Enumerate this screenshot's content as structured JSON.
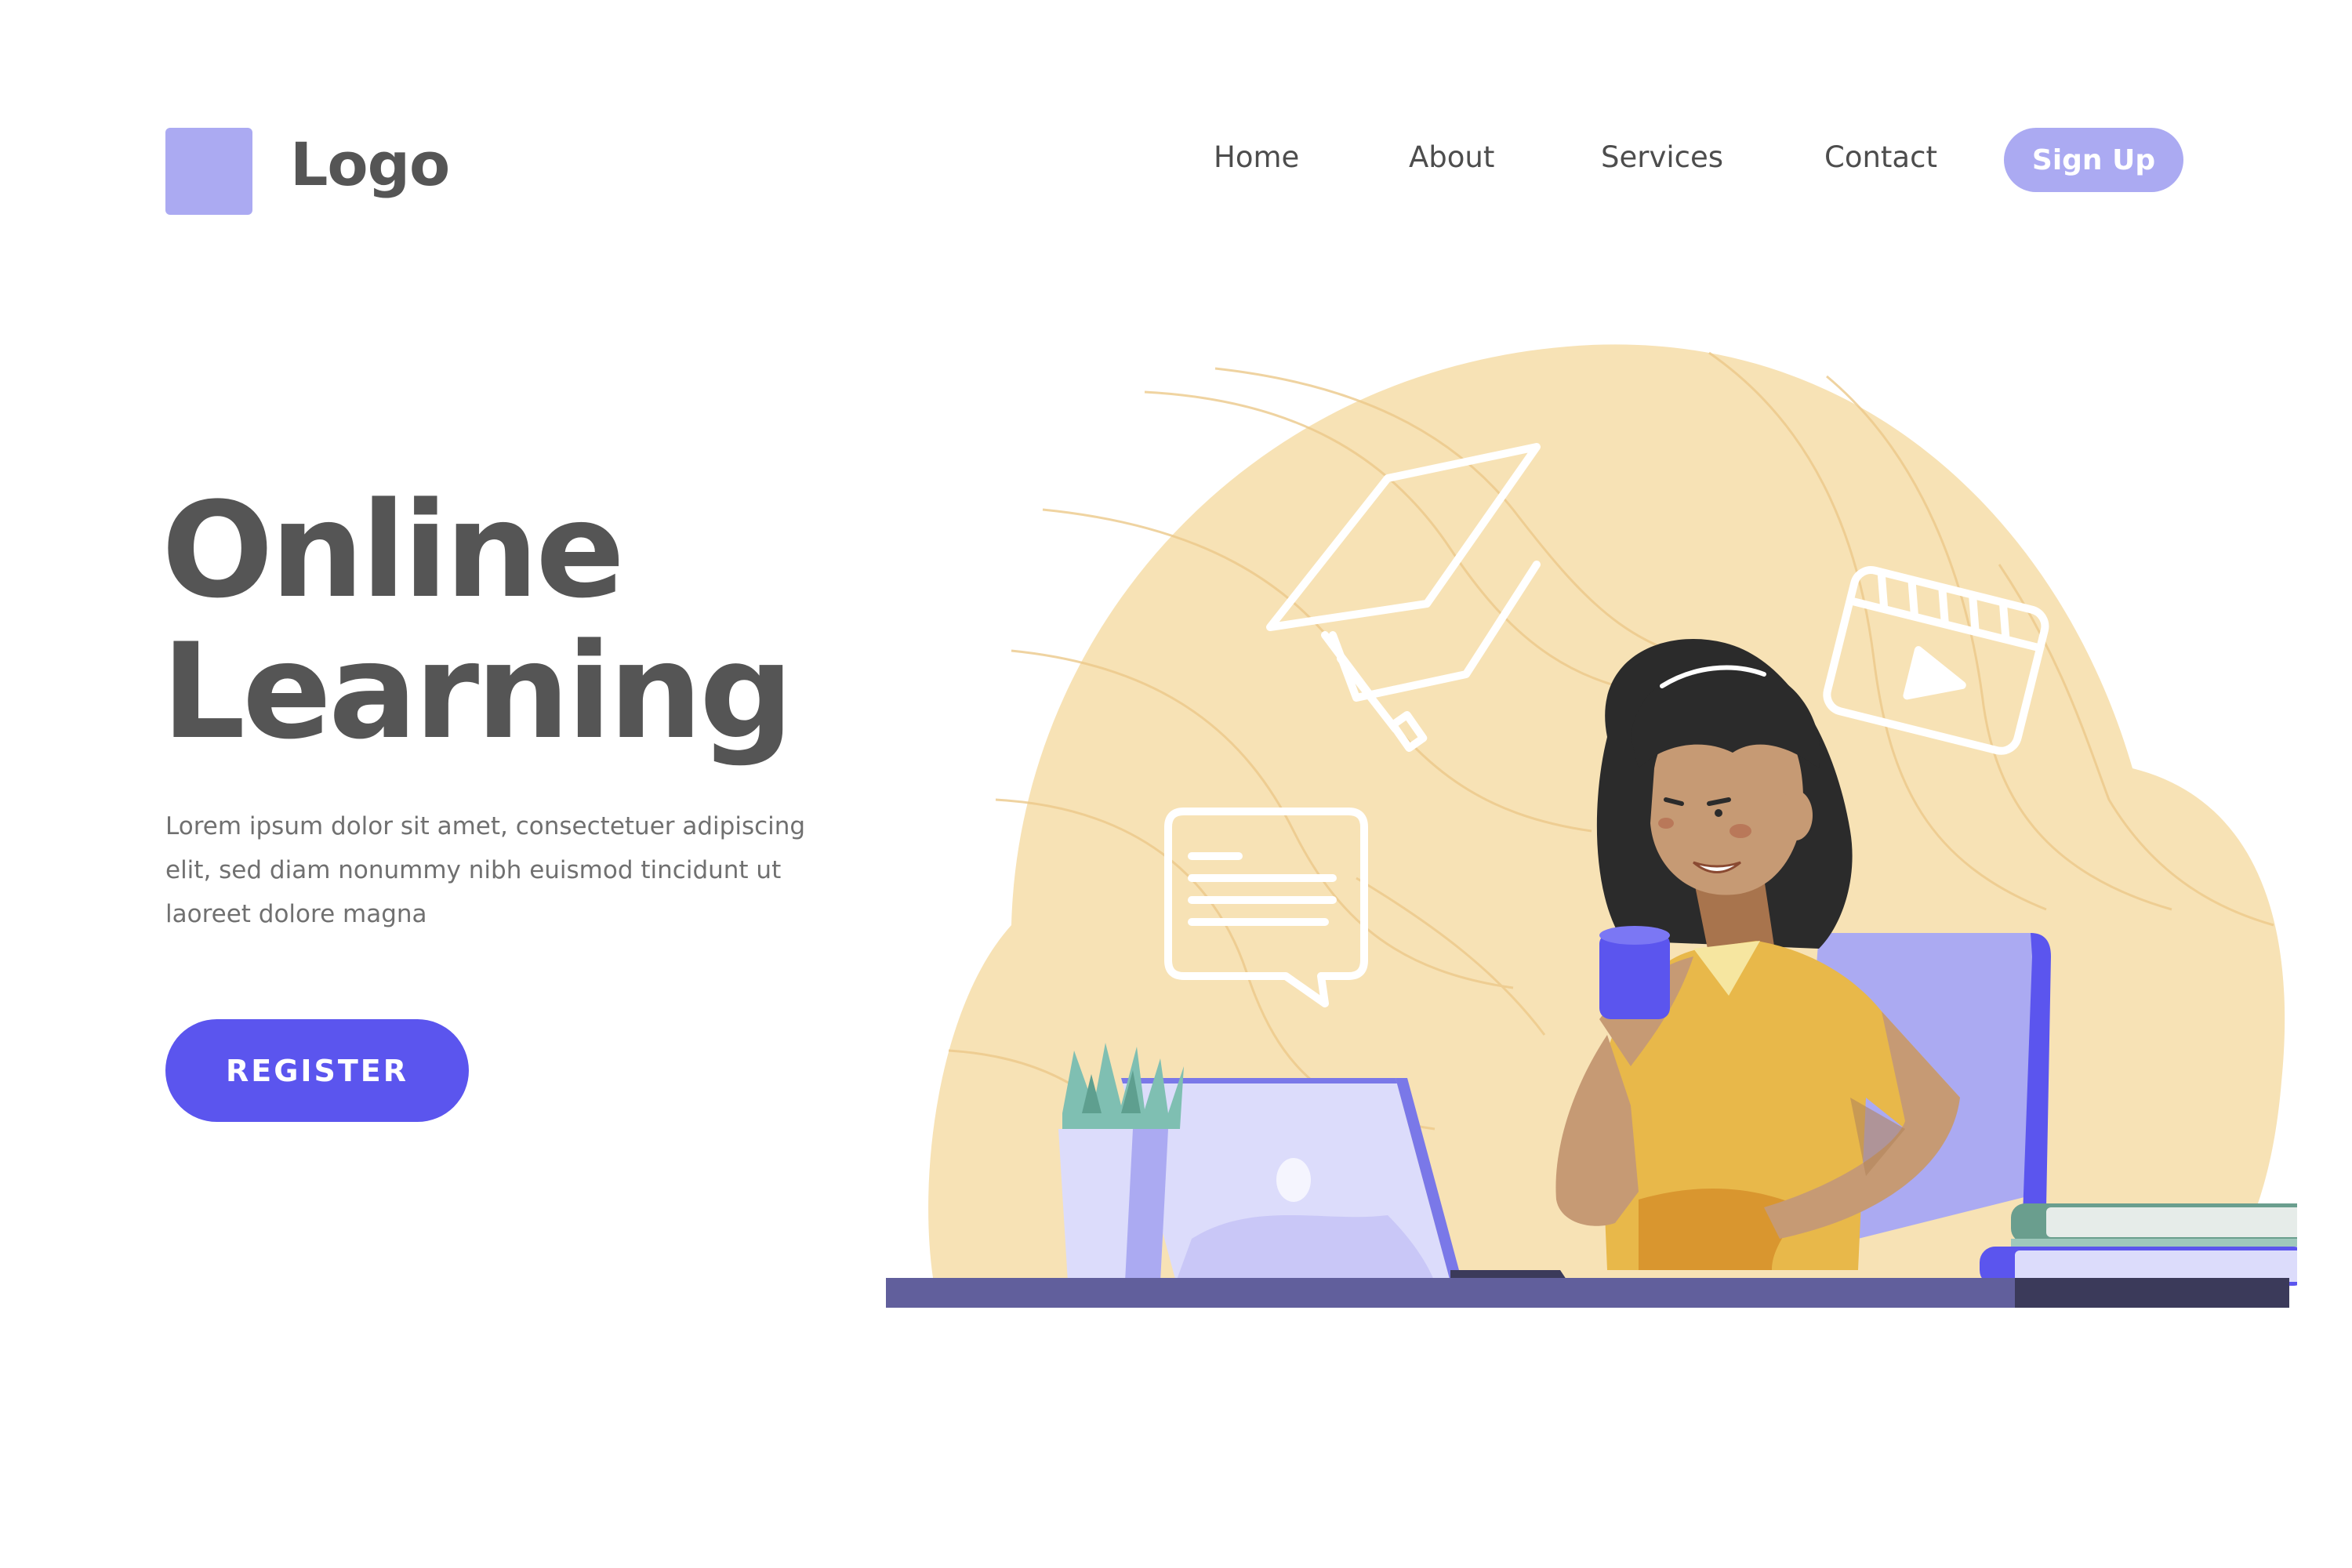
{
  "header": {
    "logo_text": "Logo",
    "nav": [
      {
        "label": "Home"
      },
      {
        "label": "About"
      },
      {
        "label": "Services"
      },
      {
        "label": "Contact"
      }
    ],
    "signup_label": "Sign Up"
  },
  "hero": {
    "title_line1": "Online",
    "title_line2": "Learning",
    "description": "Lorem ipsum dolor sit amet, consectetuer adipiscing elit, sed diam nonummy nibh euismod tincidunt ut laoreet dolore magna",
    "register_label": "REGISTER"
  },
  "colors": {
    "accent": "#5b55ee",
    "accent_light": "#abaaf2",
    "blob": "#f7e2b5",
    "text_dark": "#555555",
    "shirt": "#e8b84a",
    "desk": "#615f9c"
  },
  "icons": [
    "graduation-cap-icon",
    "video-play-icon",
    "chat-message-icon"
  ]
}
